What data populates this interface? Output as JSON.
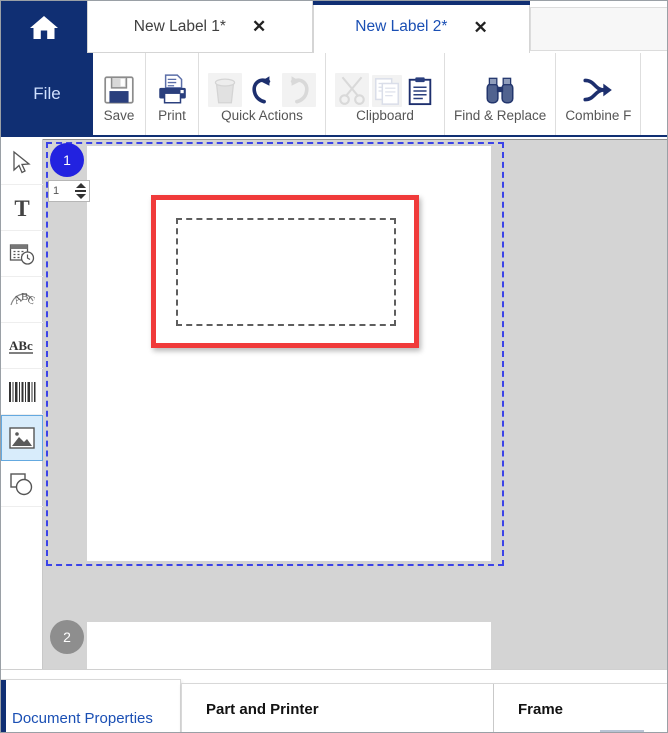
{
  "window": {
    "home_icon": "home-icon",
    "accent_navy": "#102f73",
    "accent_link": "#1a4fb4"
  },
  "tabs": [
    {
      "label": "New Label 1*",
      "close": "✕",
      "active": false
    },
    {
      "label": "New Label 2*",
      "close": "✕",
      "active": true
    }
  ],
  "ribbon": {
    "file_label": "File",
    "groups": [
      {
        "label": "Save",
        "icons": [
          "save-floppy-icon"
        ]
      },
      {
        "label": "Print",
        "icons": [
          "printer-icon"
        ]
      },
      {
        "label": "Quick Actions",
        "icons": [
          "delete-trash-icon",
          "undo-arrow-icon",
          "redo-arrow-icon"
        ]
      },
      {
        "label": "Clipboard",
        "icons": [
          "cut-scissors-icon",
          "copy-pages-icon",
          "paste-clipboard-icon"
        ]
      },
      {
        "label": "Find & Replace",
        "icons": [
          "binoculars-icon"
        ]
      },
      {
        "label": "Combine F",
        "icons": [
          "combine-merge-icon"
        ]
      }
    ]
  },
  "tools": [
    {
      "name": "select-pointer-tool",
      "selected": false
    },
    {
      "name": "text-tool",
      "selected": false
    },
    {
      "name": "datetime-tool",
      "selected": false
    },
    {
      "name": "curved-text-tool",
      "selected": false
    },
    {
      "name": "paragraph-text-tool",
      "selected": false
    },
    {
      "name": "barcode-tool",
      "selected": false
    },
    {
      "name": "image-tool",
      "selected": true
    },
    {
      "name": "shape-tool",
      "selected": false
    }
  ],
  "canvas": {
    "pages": [
      {
        "number": "1",
        "active": true
      },
      {
        "number": "2",
        "active": false
      }
    ],
    "page_spinner_value": "1",
    "selected_object": "image-frame",
    "selection_color": "#f03a3a",
    "page_outline_color": "#3b43e8"
  },
  "bottom": {
    "document_properties_label": "Document Properties",
    "columns": [
      {
        "label": "Part and Printer"
      },
      {
        "label": "Frame"
      }
    ]
  }
}
